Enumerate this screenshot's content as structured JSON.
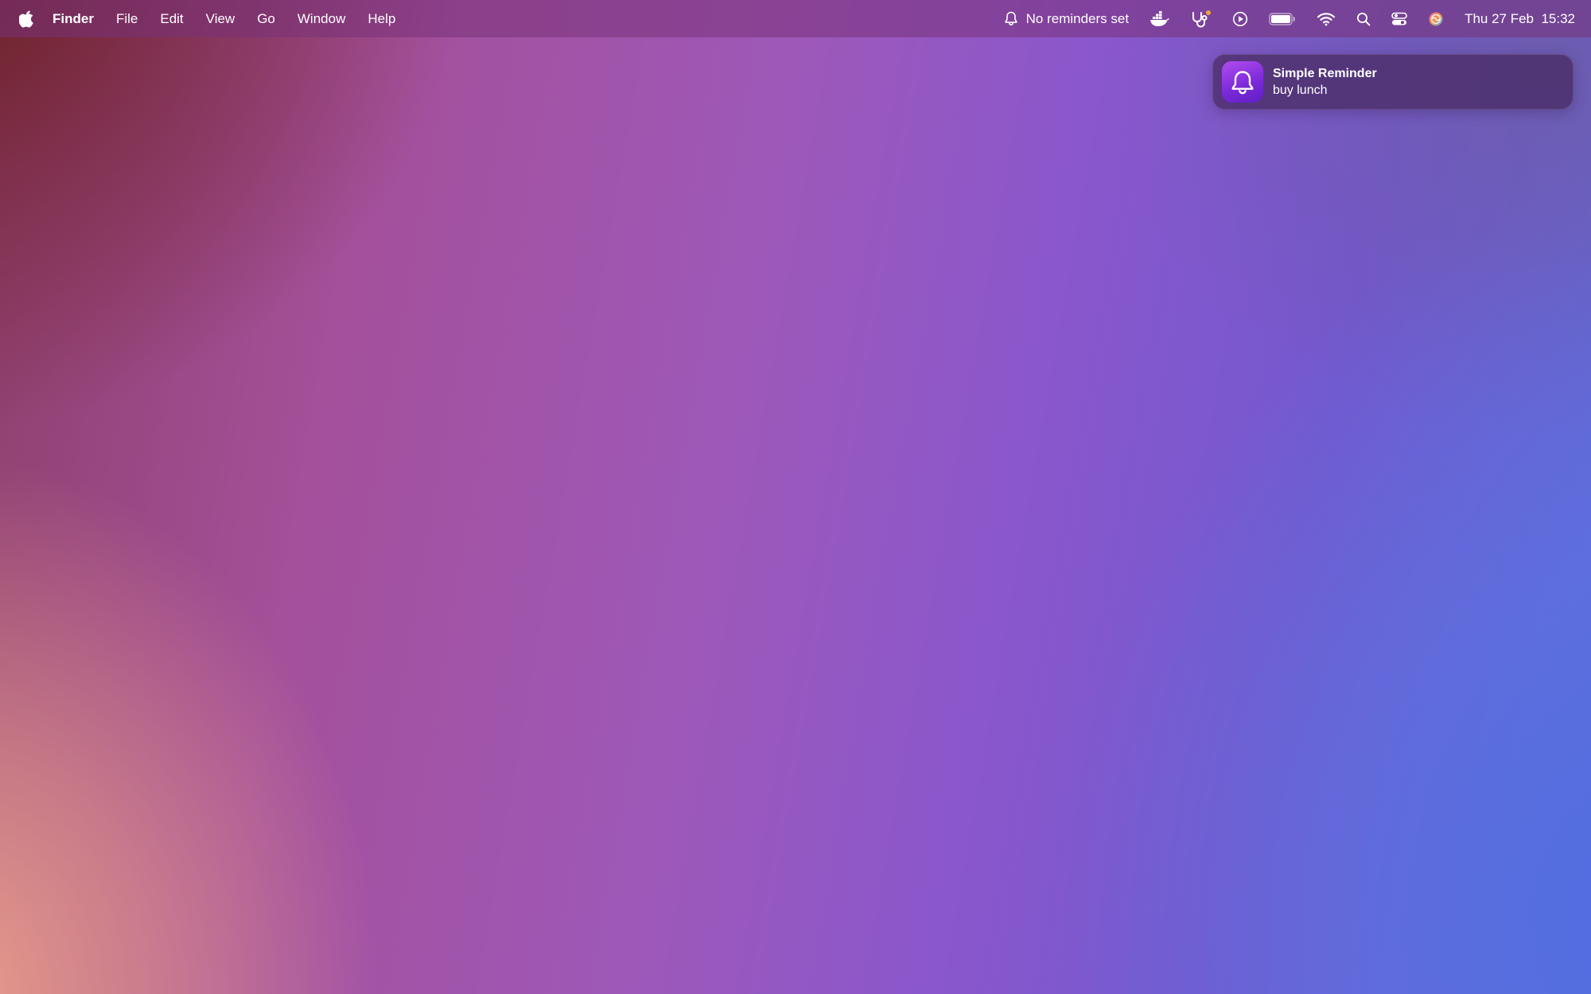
{
  "menubar": {
    "apple_icon": "apple-logo-icon",
    "app_name": "Finder",
    "menus": [
      "File",
      "Edit",
      "View",
      "Go",
      "Window",
      "Help"
    ],
    "status": {
      "reminder_text": "No reminders set",
      "reminder_icon": "bell-icon",
      "icons": [
        "docker-icon",
        "stethoscope-icon",
        "play-circle-icon",
        "battery-icon",
        "wifi-icon",
        "search-icon",
        "control-center-icon",
        "siri-icon"
      ],
      "datetime": "Thu 27 Feb  15:32"
    }
  },
  "notification": {
    "app_icon": "bell-icon",
    "title": "Simple Reminder",
    "body": "buy lunch",
    "accent_color": "#8a2ee0"
  },
  "colors": {
    "menubar_bg": "#7a3480",
    "notification_bg": "#4a2a66",
    "text": "#ffffff"
  }
}
